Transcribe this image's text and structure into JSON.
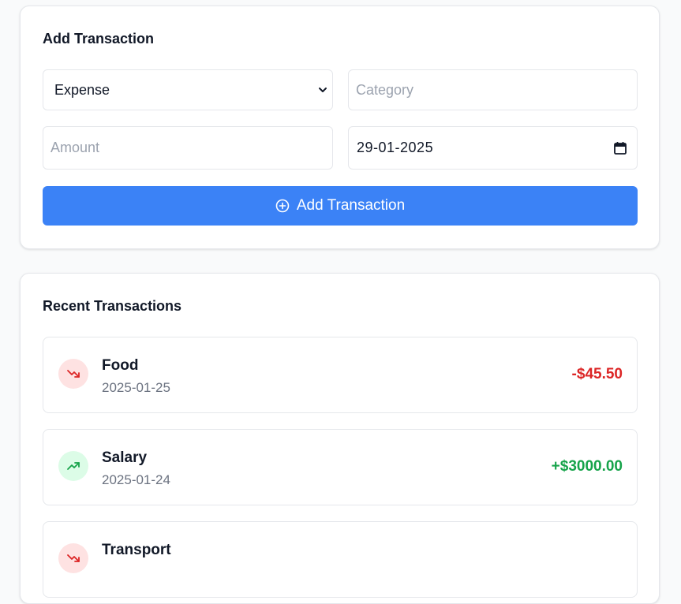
{
  "add_form": {
    "title": "Add Transaction",
    "type_value": "Expense",
    "category_placeholder": "Category",
    "amount_placeholder": "Amount",
    "date_value": "29-01-2025",
    "submit_label": "Add Transaction"
  },
  "recent": {
    "title": "Recent Transactions",
    "items": [
      {
        "category": "Food",
        "date": "2025-01-25",
        "amount": "-$45.50",
        "kind": "expense",
        "icon": "trending-down-icon"
      },
      {
        "category": "Salary",
        "date": "2025-01-24",
        "amount": "+$3000.00",
        "kind": "income",
        "icon": "trending-up-icon"
      },
      {
        "category": "Transport",
        "date": "",
        "amount": "",
        "kind": "expense",
        "icon": "trending-down-icon"
      }
    ]
  },
  "colors": {
    "primary": "#3b82f6",
    "expense": "#dc2626",
    "expense_bg": "#fee2e2",
    "income": "#16a34a",
    "income_bg": "#dcfce7"
  }
}
